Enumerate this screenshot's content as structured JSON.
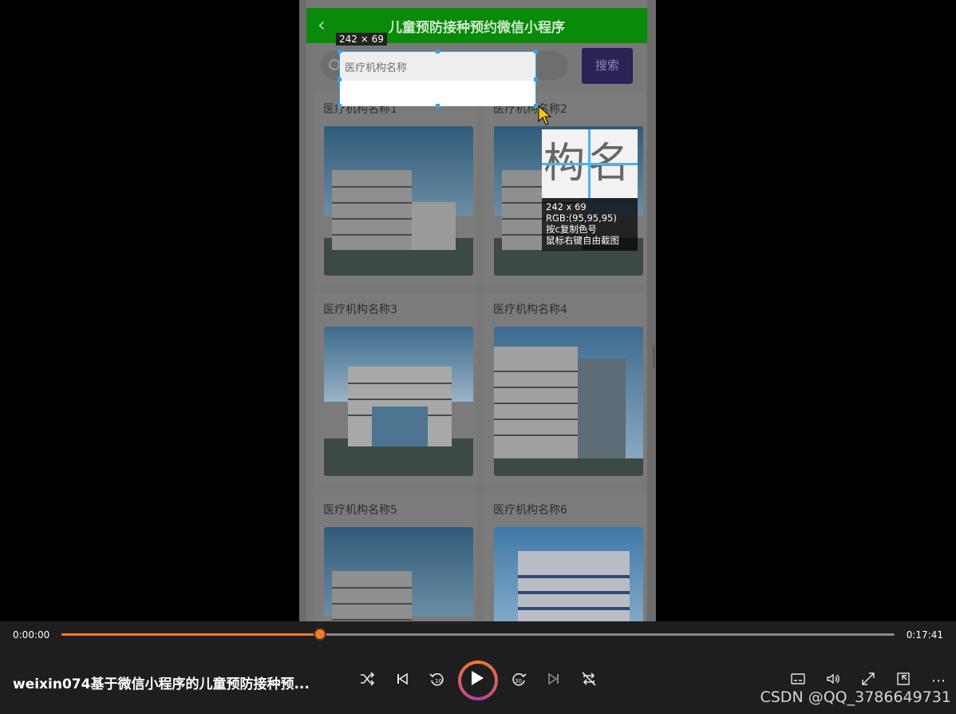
{
  "app": {
    "title": "儿童预防接种预约微信小程序",
    "back_icon": "chevron-left-icon"
  },
  "search": {
    "placeholder": "医疗机构名称",
    "button_label": "搜索"
  },
  "cards": [
    {
      "label": "医疗机构名称1"
    },
    {
      "label": "医疗机构名称2"
    },
    {
      "label": "医疗机构名称3"
    },
    {
      "label": "医疗机构名称4"
    },
    {
      "label": "医疗机构名称5"
    },
    {
      "label": "医疗机构名称6"
    }
  ],
  "screenshot_tool": {
    "size_label": "242 × 69",
    "zoom_glyphs": "构名",
    "info_size": "242 x 69",
    "info_rgb": "RGB:(95,95,95)",
    "info_copy": "按c复制色号",
    "info_hint": "鼠标右键自由截图"
  },
  "player": {
    "current_time": "0:00:00",
    "duration": "0:17:41",
    "progress_fraction": 0.31,
    "video_title": "weixin074基于微信小程序的儿童预防接种预...",
    "watermark": "CSDN @QQ_3786649731",
    "accent_color": "#f07c2c",
    "controls": [
      "shuffle-icon",
      "previous-icon",
      "rewind-10-icon",
      "play-icon",
      "forward-30-icon",
      "next-icon",
      "repeat-off-icon"
    ],
    "right_controls": [
      "subtitles-icon",
      "volume-icon",
      "fullscreen-icon",
      "mini-player-icon",
      "more-icon"
    ]
  }
}
